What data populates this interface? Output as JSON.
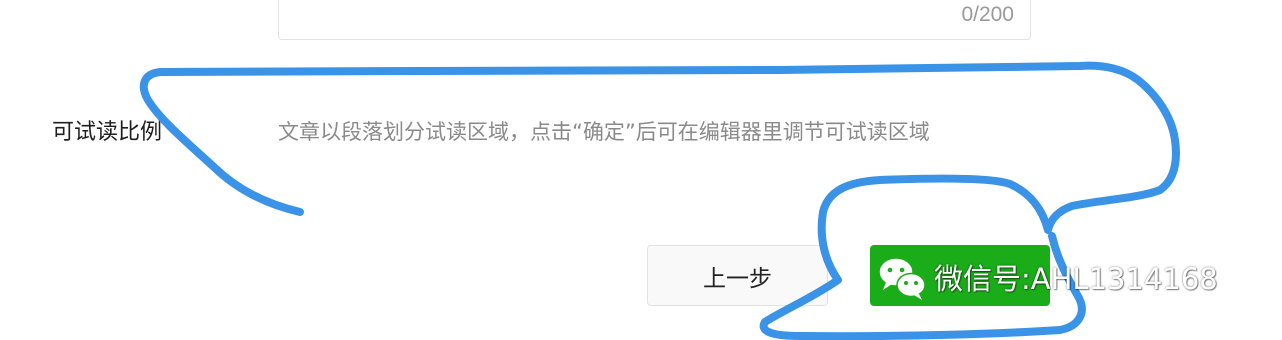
{
  "description_field": {
    "char_count": "0/200"
  },
  "trial_read": {
    "label": "可试读比例",
    "hint": "文章以段落划分试读区域，点击“确定”后可在编辑器里调节可试读区域"
  },
  "actions": {
    "prev_label": "上一步",
    "confirm_color": "#1aad19"
  },
  "watermark": {
    "icon": "wechat-icon",
    "text": "微信号:AHL1314168"
  },
  "annotation": {
    "color": "#3a93e6"
  }
}
